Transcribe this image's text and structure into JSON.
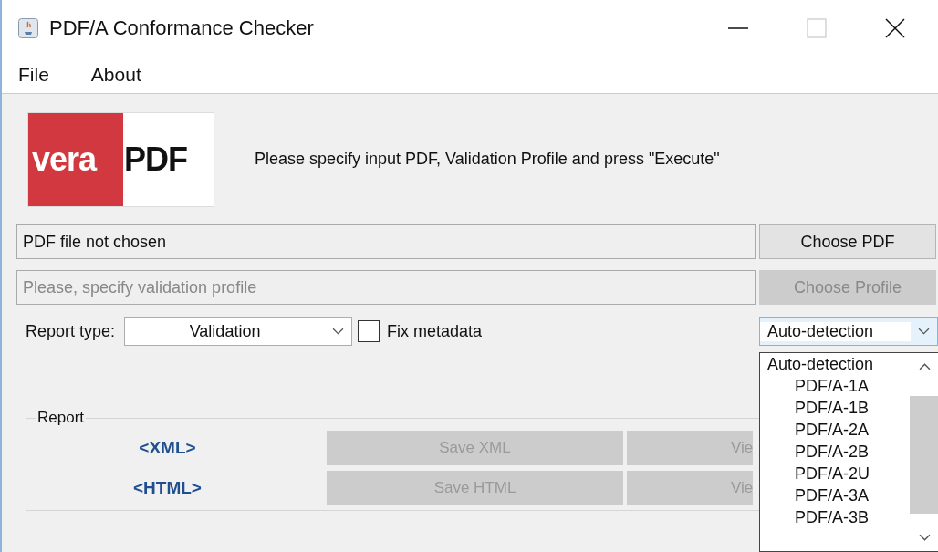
{
  "window": {
    "title": "PDF/A Conformance Checker"
  },
  "menu": [
    "File",
    "About"
  ],
  "logo": {
    "light": "vera",
    "bold": "PDF"
  },
  "message": "Please specify input PDF, Validation Profile and press \"Execute\"",
  "pdf_field": {
    "value": "PDF file not chosen"
  },
  "choose_pdf": {
    "label": "Choose PDF",
    "disabled": false
  },
  "profile_field": {
    "placeholder": "Please, specify validation profile"
  },
  "choose_profile": {
    "label": "Choose Profile",
    "disabled": true
  },
  "report_type": {
    "label": "Report type:",
    "value": "Validation"
  },
  "fix_metadata": {
    "label": "Fix metadata",
    "checked": false
  },
  "flavour": {
    "value": "Auto-detection",
    "expanded": true,
    "options": [
      {
        "label": "Auto-detection",
        "kind": "auto"
      },
      {
        "label": "PDF/A-1A",
        "kind": "flavour"
      },
      {
        "label": "PDF/A-1B",
        "kind": "flavour"
      },
      {
        "label": "PDF/A-2A",
        "kind": "flavour"
      },
      {
        "label": "PDF/A-2B",
        "kind": "flavour"
      },
      {
        "label": "PDF/A-2U",
        "kind": "flavour"
      },
      {
        "label": "PDF/A-3A",
        "kind": "flavour"
      },
      {
        "label": "PDF/A-3B",
        "kind": "flavour"
      }
    ]
  },
  "report": {
    "title": "Report",
    "rows": [
      {
        "format": "<XML>",
        "save": {
          "label": "Save XML",
          "disabled": true
        },
        "view": {
          "label": "Vie",
          "disabled": true
        }
      },
      {
        "format": "<HTML>",
        "save": {
          "label": "Save HTML",
          "disabled": true
        },
        "view": {
          "label": "Vie",
          "disabled": true
        }
      }
    ]
  }
}
